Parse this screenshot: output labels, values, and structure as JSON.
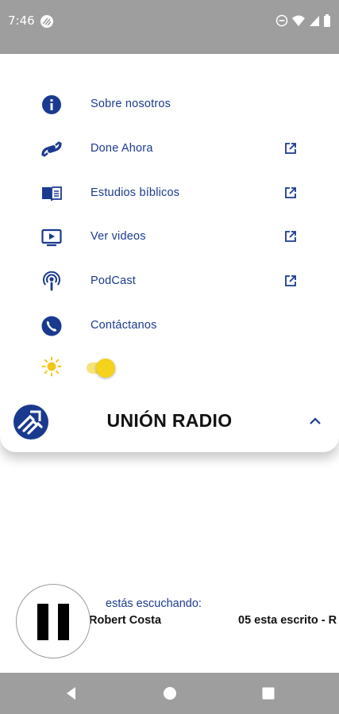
{
  "status_bar": {
    "time": "7:46",
    "left_icon": "app-notification-icon",
    "right_icons": [
      "do-not-disturb-icon",
      "wifi-icon",
      "signal-icon",
      "battery-icon"
    ]
  },
  "menu": {
    "items": [
      {
        "label": "Sobre nosotros",
        "icon": "info-icon",
        "external": false
      },
      {
        "label": "Done Ahora",
        "icon": "donate-icon",
        "external": true
      },
      {
        "label": "Estudios bíblicos",
        "icon": "book-icon",
        "external": true
      },
      {
        "label": "Ver videos",
        "icon": "tv-play-icon",
        "external": true
      },
      {
        "label": "PodCast",
        "icon": "podcast-icon",
        "external": true
      },
      {
        "label": "Contáctanos",
        "icon": "phone-icon",
        "external": false
      }
    ],
    "theme_toggle": {
      "icon": "sun-icon",
      "on": true
    }
  },
  "brand": {
    "title": "UNIÓN RADIO",
    "collapse_icon": "chevron-up-icon"
  },
  "player": {
    "label": "estás escuchando:",
    "artist": "Robert Costa",
    "track": "05 esta escrito - R",
    "state": "playing"
  },
  "colors": {
    "accent": "#1a3a8f",
    "toggle": "#f5d21b",
    "system_bar": "#9e9e9e"
  }
}
